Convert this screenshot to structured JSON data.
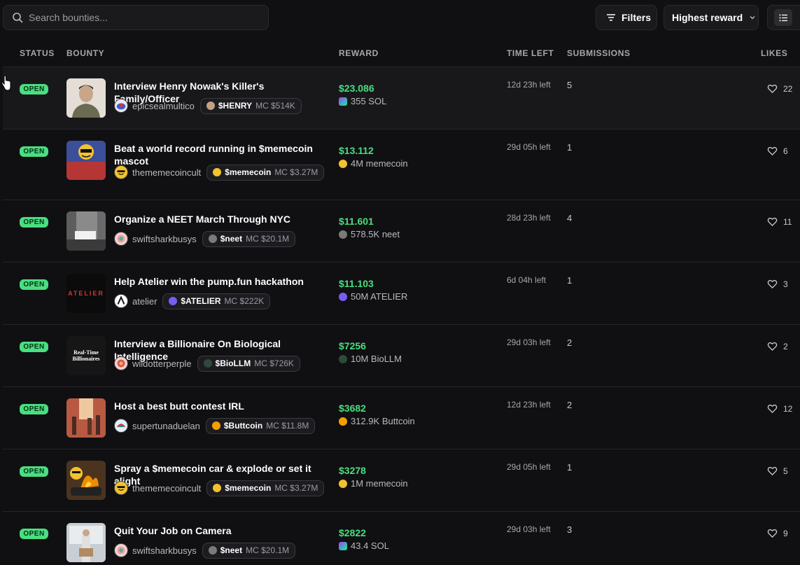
{
  "search": {
    "placeholder": "Search bounties..."
  },
  "toolbar": {
    "filters_label": "Filters",
    "sort_label": "Highest reward"
  },
  "columns": {
    "status": "STATUS",
    "bounty": "BOUNTY",
    "reward": "REWARD",
    "time_left": "TIME LEFT",
    "submissions": "SUBMISSIONS",
    "likes": "LIKES"
  },
  "colors": {
    "accent_green": "#4ade80",
    "background": "#101012"
  },
  "bounties": [
    {
      "status": "OPEN",
      "title": "Interview Henry Nowak's Killer's Family/Officer",
      "user": "epicsealmultico",
      "token_symbol": "$HENRY",
      "token_mc": "MC $514K",
      "reward_usd": "$23.086",
      "reward_amount": "355 SOL",
      "time_left": "12d 23h left",
      "submissions": "5",
      "likes": "22"
    },
    {
      "status": "OPEN",
      "title": "Beat a world record running in $memecoin mascot",
      "user": "thememecoincult",
      "token_symbol": "$memecoin",
      "token_mc": "MC $3.27M",
      "reward_usd": "$13.112",
      "reward_amount": "4M memecoin",
      "time_left": "29d 05h left",
      "submissions": "1",
      "likes": "6"
    },
    {
      "status": "OPEN",
      "title": "Organize a NEET March Through NYC",
      "user": "swiftsharkbusys",
      "token_symbol": "$neet",
      "token_mc": "MC $20.1M",
      "reward_usd": "$11.601",
      "reward_amount": "578.5K neet",
      "time_left": "28d 23h left",
      "submissions": "4",
      "likes": "11"
    },
    {
      "status": "OPEN",
      "title": "Help Atelier win the pump.fun hackathon",
      "user": "atelier",
      "token_symbol": "$ATELIER",
      "token_mc": "MC $222K",
      "reward_usd": "$11.103",
      "reward_amount": "50M ATELIER",
      "time_left": "6d 04h left",
      "submissions": "1",
      "likes": "3"
    },
    {
      "status": "OPEN",
      "title": "Interview a Billionaire On Biological Intelligence",
      "user": "wildotterperple",
      "token_symbol": "$BioLLM",
      "token_mc": "MC $726K",
      "reward_usd": "$7256",
      "reward_amount": "10M BioLLM",
      "time_left": "29d 03h left",
      "submissions": "2",
      "likes": "2",
      "thumb_text": "Real-Time Billionaires"
    },
    {
      "status": "OPEN",
      "title": "Host a best butt contest IRL",
      "user": "supertunaduelan",
      "token_symbol": "$Buttcoin",
      "token_mc": "MC $11.8M",
      "reward_usd": "$3682",
      "reward_amount": "312.9K Buttcoin",
      "time_left": "12d 23h left",
      "submissions": "2",
      "likes": "12"
    },
    {
      "status": "OPEN",
      "title": "Spray a $memecoin car & explode or set it alight",
      "user": "thememecoincult",
      "token_symbol": "$memecoin",
      "token_mc": "MC $3.27M",
      "reward_usd": "$3278",
      "reward_amount": "1M memecoin",
      "time_left": "29d 05h left",
      "submissions": "1",
      "likes": "5"
    },
    {
      "status": "OPEN",
      "title": "Quit Your Job on Camera",
      "user": "swiftsharkbusys",
      "token_symbol": "$neet",
      "token_mc": "MC $20.1M",
      "reward_usd": "$2822",
      "reward_amount": "43.4 SOL",
      "time_left": "29d 03h left",
      "submissions": "3",
      "likes": "9"
    }
  ],
  "thumb_atelier_text": "ATELIER"
}
